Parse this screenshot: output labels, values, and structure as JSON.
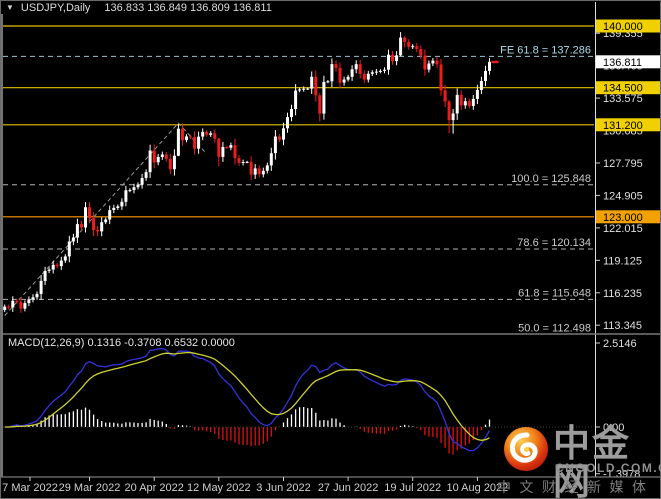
{
  "window": {
    "title_symbol": "USDJPY,Daily",
    "ohlc_text": "136.833 136.849 136.809 136.811",
    "toggle_icon": "collapse-triangle"
  },
  "chart_data": {
    "type": "candlestick",
    "symbol": "USDJPY",
    "timeframe": "Daily",
    "quote": {
      "open": "136.833",
      "high": "136.849",
      "low": "136.809",
      "close": "136.811"
    },
    "price_pane": {
      "ylim": [
        112.74,
        141.065
      ],
      "grid": false,
      "axis_ticks": [
        {
          "label": "139.355",
          "price": 139.355
        },
        {
          "label": "136.465",
          "price": 136.465
        },
        {
          "label": "133.575",
          "price": 133.575
        },
        {
          "label": "130.685",
          "price": 130.685
        },
        {
          "label": "127.795",
          "price": 127.795
        },
        {
          "label": "124.905",
          "price": 124.905
        },
        {
          "label": "122.015",
          "price": 122.015
        },
        {
          "label": "119.125",
          "price": 119.125
        },
        {
          "label": "116.235",
          "price": 116.235
        },
        {
          "label": "113.345",
          "price": 113.345
        }
      ],
      "levels": [
        {
          "label": "140.000",
          "price": 140.0,
          "line": "#e3c000",
          "box": "#f0d000"
        },
        {
          "label": "134.500",
          "price": 134.5,
          "line": "#e3c000",
          "box": "#f0d000"
        },
        {
          "label": "131.200",
          "price": 131.2,
          "line": "#e3c000",
          "box": "#f0d000"
        },
        {
          "label": "123.000",
          "price": 123.0,
          "line": "#ff9400",
          "box": "#f2a200"
        }
      ],
      "fib_annotations": [
        {
          "label": "FE 61.8 = 137.286",
          "price": 137.286,
          "color": "#aadbe8",
          "dash": "5 4"
        },
        {
          "label": "100.0 = 125.848",
          "price": 125.848,
          "color": "#c8c8c8",
          "dash": "5 4"
        },
        {
          "label": "78.6 = 120.134",
          "price": 120.134,
          "color": "#c8c8c8",
          "dash": "5 4"
        },
        {
          "label": "61.8 = 115.648",
          "price": 115.648,
          "color": "#c8c8c8",
          "dash": "5 4"
        },
        {
          "label": "50.0 = 112.498",
          "price": 112.498,
          "color": "#c8c8c8",
          "dash": "5 4"
        }
      ],
      "current_price": {
        "label": "136.811",
        "price": 136.811,
        "box": "#ffffff",
        "marker": "#ee1c1c"
      }
    },
    "candles": {
      "closes": [
        115.0,
        114.93,
        115.52,
        115.43,
        114.82,
        115.31,
        115.65,
        115.83,
        116.13,
        117.29,
        118.18,
        118.3,
        118.73,
        118.61,
        119.1,
        119.47,
        120.8,
        121.16,
        122.35,
        122.05,
        123.86,
        122.88,
        121.83,
        121.7,
        122.52,
        122.76,
        123.6,
        123.79,
        123.93,
        124.34,
        125.36,
        125.38,
        125.64,
        125.87,
        126.46,
        126.98,
        128.91,
        127.86,
        128.33,
        128.55,
        128.16,
        127.24,
        128.44,
        130.85,
        129.83,
        130.15,
        130.1,
        129.07,
        130.14,
        130.56,
        130.31,
        130.44,
        129.96,
        128.34,
        129.22,
        129.16,
        129.38,
        128.22,
        127.79,
        127.88,
        127.89,
        126.76,
        127.31,
        126.79,
        127.1,
        127.58,
        128.67,
        130.15,
        129.87,
        130.88,
        131.88,
        132.6,
        134.25,
        134.35,
        134.41,
        134.42,
        135.47,
        133.82,
        132.2,
        135.02,
        135.07,
        136.6,
        136.26,
        134.95,
        135.22,
        135.47,
        136.14,
        136.59,
        135.72,
        135.22,
        135.74,
        135.87,
        135.93,
        136.0,
        136.1,
        137.44,
        136.87,
        137.38,
        138.96,
        138.57,
        138.13,
        138.2,
        137.96,
        137.36,
        136.12,
        136.66,
        136.91,
        136.58,
        134.27,
        133.27,
        131.61,
        132.2,
        133.86,
        132.93,
        133.3,
        132.88,
        133.5,
        134.3,
        135.1,
        136.0,
        136.81
      ],
      "wick_overrides": {
        "23": [
          122.2,
          121.28
        ],
        "43": [
          131.26,
          128.4
        ],
        "53": [
          130.05,
          127.52
        ],
        "78": [
          134.0,
          131.5
        ],
        "98": [
          139.45,
          137.3
        ],
        "99": [
          139.1,
          138.1
        ],
        "110": [
          133.4,
          130.45
        ],
        "111": [
          132.6,
          130.4
        ]
      }
    },
    "zigzag_trendline": [
      [
        0,
        114.2
      ],
      [
        43,
        131.35
      ],
      [
        50,
        128.6
      ]
    ],
    "macd_pane": {
      "label": "MACD(12,26,9) 0.1316 -0.3708 0.6532 0.0000",
      "params": [
        12,
        26,
        9
      ],
      "values": [
        "0.1316",
        "-0.3708",
        "0.6532",
        "0.0000"
      ],
      "ylim": [
        -1.467,
        2.695
      ],
      "axis_ticks": [
        {
          "label": "2.5146",
          "value": 2.5146
        },
        {
          "label": "0.00",
          "value": 0.0
        },
        {
          "label": "-1.3978",
          "value": -1.3978
        }
      ]
    },
    "x_axis": {
      "labels": [
        "7 Mar 2022",
        "29 Mar 2022",
        "20 Apr 2022",
        "12 May 2022",
        "3 Jun 2022",
        "27 Jun 2022",
        "19 Jul 2022",
        "10 Aug 2022"
      ],
      "tick_indices": [
        5,
        21,
        37,
        53,
        69,
        85,
        101,
        117
      ]
    }
  },
  "colors": {
    "bg": "#000000",
    "candle_up": "#ffffff",
    "candle_down": "#ee1c1c",
    "macd_line": "#3333dd",
    "signal_line": "#cfcf30",
    "hist_pos": "#ffffff",
    "hist_neg": "#dd1111",
    "axis_text": "#e0e0e0",
    "date_text": "#d0d0d0",
    "zigzag": "#9a9a9a",
    "frame": "#787878"
  },
  "watermark": {
    "logo": "cngold-swirl-logo",
    "title": "中金网",
    "domain": "CNGOLD.COM.CN",
    "tagline": "中文财经新媒体"
  }
}
